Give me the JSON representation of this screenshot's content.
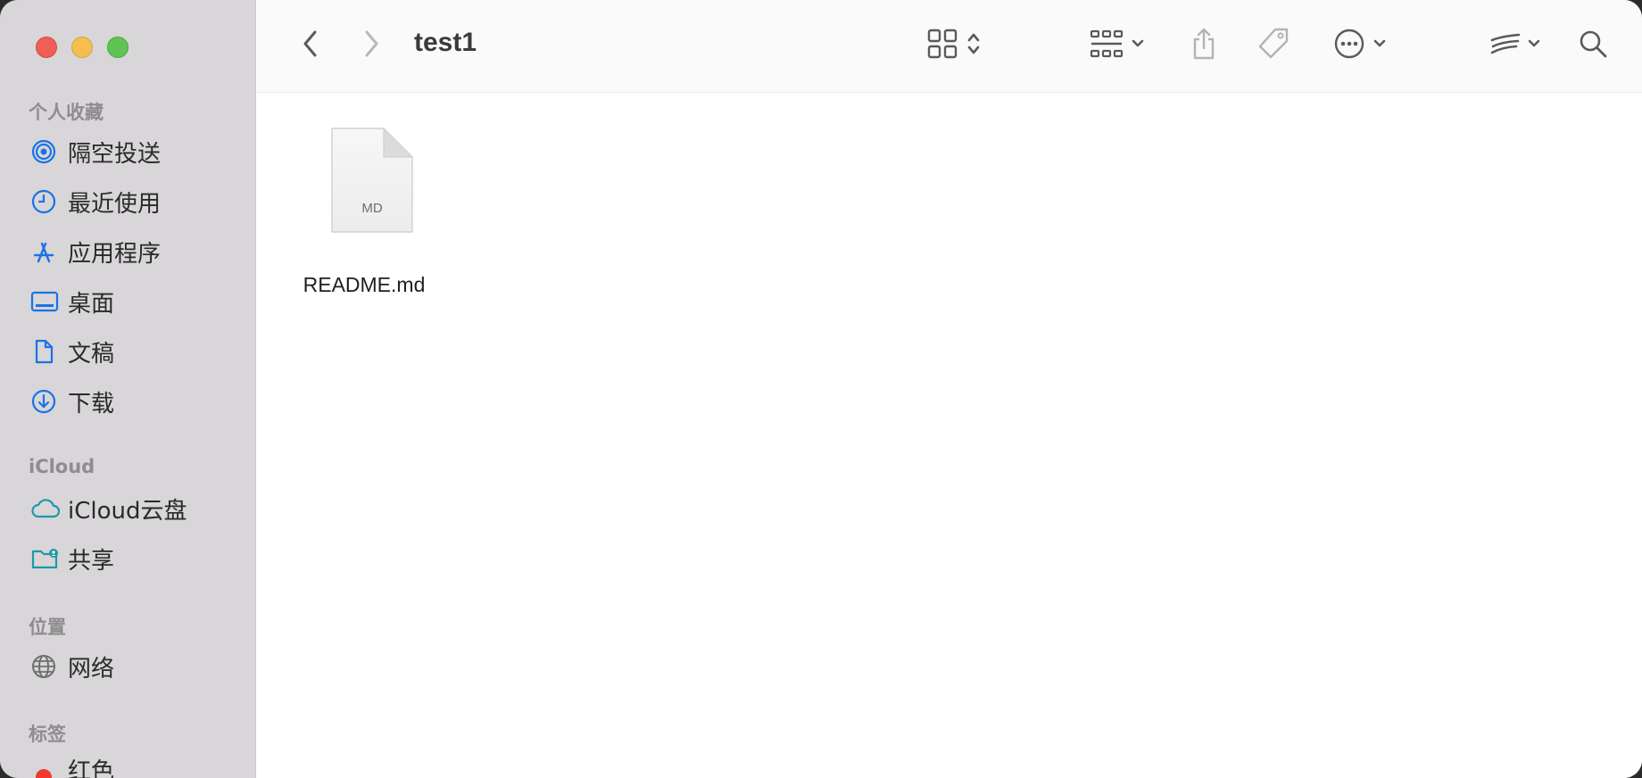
{
  "window": {
    "title": "test1"
  },
  "sidebar": {
    "favorites_title": "个人收藏",
    "favorites": [
      {
        "label": "隔空投送",
        "icon": "airdrop-icon"
      },
      {
        "label": "最近使用",
        "icon": "clock-icon"
      },
      {
        "label": "应用程序",
        "icon": "applications-icon"
      },
      {
        "label": "桌面",
        "icon": "desktop-icon"
      },
      {
        "label": "文稿",
        "icon": "document-icon"
      },
      {
        "label": "下载",
        "icon": "download-icon"
      }
    ],
    "icloud_title": "iCloud",
    "icloud": [
      {
        "label": "iCloud云盘",
        "icon": "cloud-icon"
      },
      {
        "label": "共享",
        "icon": "shared-folder-icon"
      }
    ],
    "locations_title": "位置",
    "locations": [
      {
        "label": "网络",
        "icon": "globe-icon"
      }
    ],
    "tags_title": "标签",
    "tags": [
      {
        "label": "红色",
        "color": "#ee3b30"
      }
    ]
  },
  "toolbar": {
    "accent": "#6a6a6a",
    "icons": [
      "back-icon",
      "forward-icon",
      "grid-view-icon",
      "group-icon",
      "share-icon",
      "tag-icon",
      "more-icon",
      "airplay-icon",
      "search-icon"
    ]
  },
  "files": [
    {
      "name": "README.md",
      "badge": "MD"
    }
  ],
  "colors": {
    "sidebar_bg": "#d8d6d8",
    "icon_blue": "#1a72e8",
    "icon_teal": "#1e9aa8"
  }
}
